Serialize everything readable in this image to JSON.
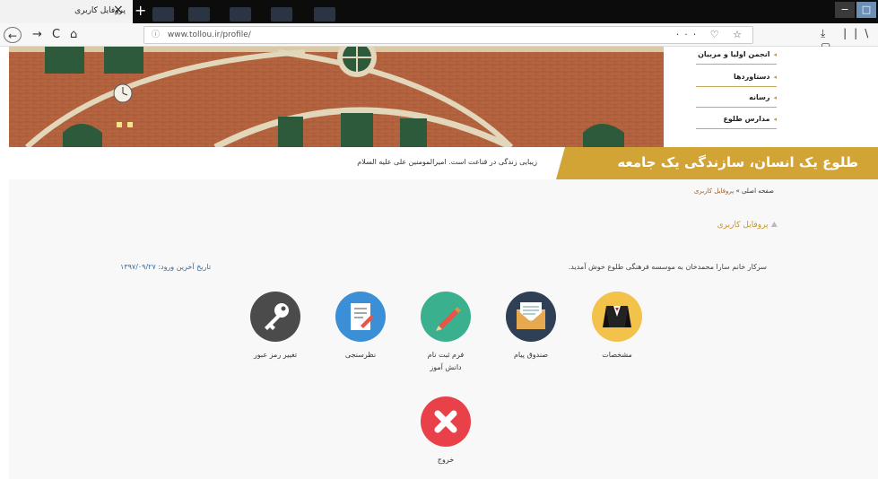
{
  "browser": {
    "tab_title": "پروفایل کاربری",
    "tab_close": "×",
    "new_tab": "+",
    "url": "www.tollou.ir/profile/",
    "url_info": "ⓘ",
    "url_icons": "··· ♡ ☆",
    "back": "←",
    "forward": "→",
    "reload": "C",
    "home": "⌂",
    "tool_icons": "⤓ ||\\ ▢",
    "win_min": "−",
    "win_max": "□"
  },
  "side_menu": {
    "items": [
      "انجمن اولیا و مربیان",
      "دستاوردها",
      "رسانه",
      "مدارس طلوع"
    ]
  },
  "banner": {
    "slogan": "طلوع یک انسان، سازندگی یک جامعه",
    "quote": "زیبایی زندگی در قناعت است. امیرالمومنین علی علیه السلام"
  },
  "breadcrumb": {
    "home": "صفحه اصلی",
    "sep": "»",
    "current": "پروفایل کاربری"
  },
  "profile": {
    "title": "پروفایل کاربری",
    "welcome": "سرکار خانم سارا محمدخان به موسسه فرهنگی طلوع خوش آمدید.",
    "last_login_label": "تاریخ آخرین ورود:",
    "last_login_value": "۱۳۹۷/۰۹/۲۷"
  },
  "tiles": [
    {
      "label": "مشخصات",
      "icon": "suit-icon",
      "color": "#f2c24a"
    },
    {
      "label": "صندوق پیام",
      "icon": "envelope-icon",
      "color": "#2f3f55"
    },
    {
      "label": "فرم ثبت نام",
      "label2": "دانش آموز",
      "icon": "pencil-icon",
      "color": "#3bb08f"
    },
    {
      "label": "نظرسنجی",
      "icon": "document-icon",
      "color": "#3b8fd6"
    },
    {
      "label": "تغییر رمز عبور",
      "icon": "key-icon",
      "color": "#4b4b4b"
    },
    {
      "label": "خروج",
      "icon": "close-icon",
      "color": "#e8414a"
    }
  ]
}
